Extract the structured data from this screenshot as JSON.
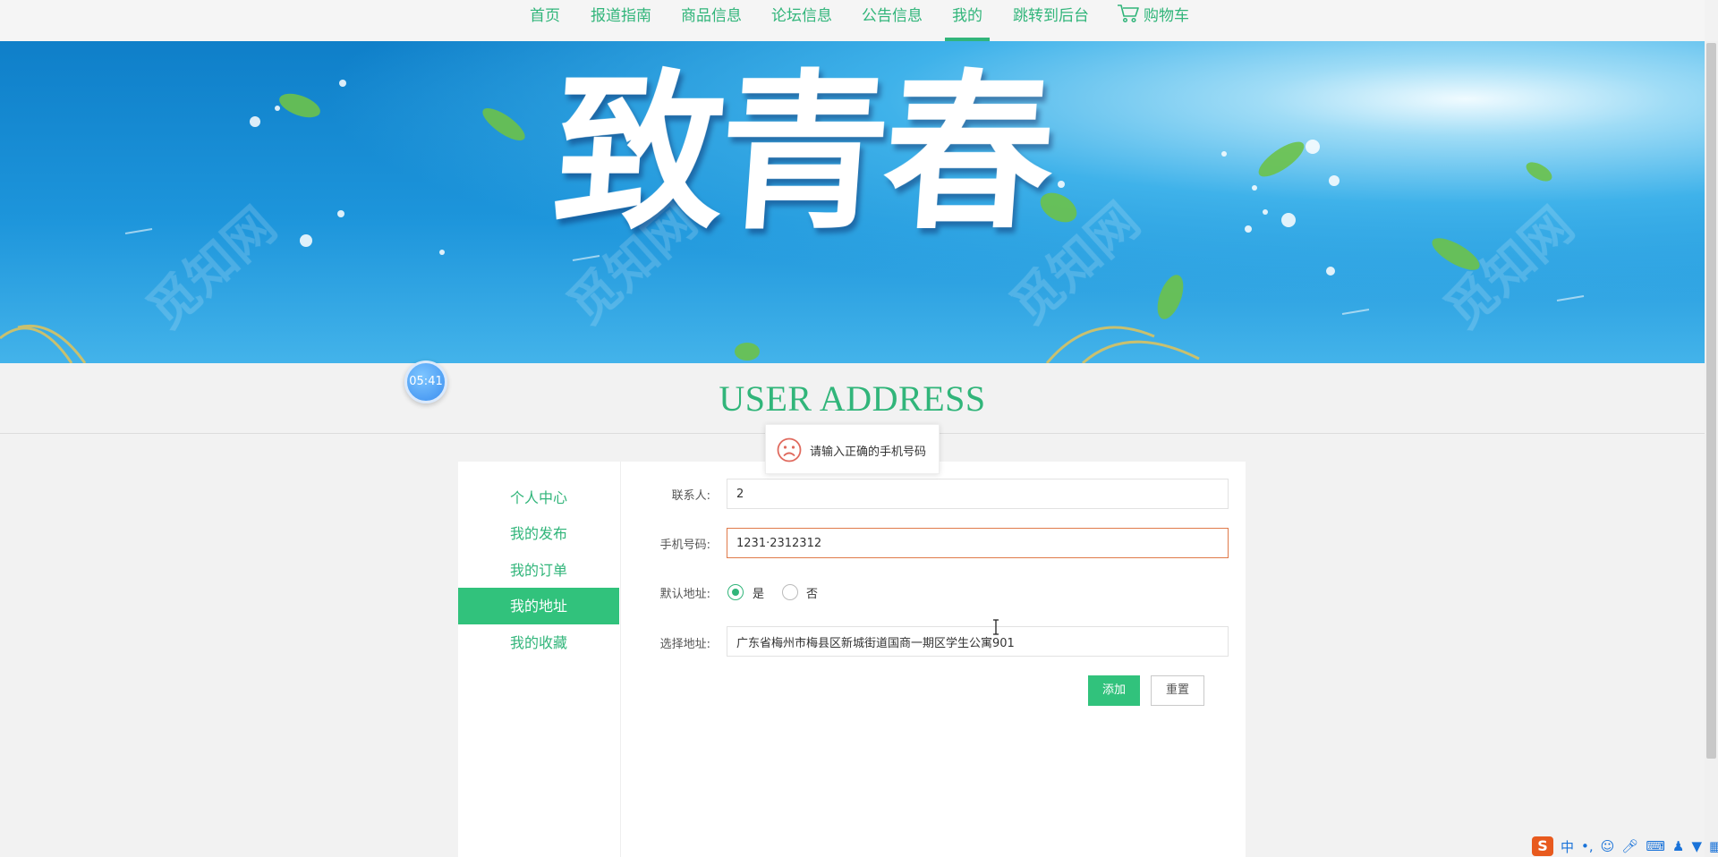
{
  "nav": {
    "items": [
      {
        "label": "首页"
      },
      {
        "label": "报道指南"
      },
      {
        "label": "商品信息"
      },
      {
        "label": "论坛信息"
      },
      {
        "label": "公告信息"
      },
      {
        "label": "我的"
      },
      {
        "label": "跳转到后台"
      }
    ],
    "cart_label": "购物车",
    "active_item": "我的"
  },
  "banner": {
    "title": "致青春",
    "watermark": "觅知网"
  },
  "section": {
    "title": "USER ADDRESS"
  },
  "timer": {
    "text": "05:41"
  },
  "toast": {
    "message": "请输入正确的手机号码",
    "icon": "sad-face-icon"
  },
  "sidebar": {
    "items": [
      {
        "label": "个人中心"
      },
      {
        "label": "我的发布"
      },
      {
        "label": "我的订单"
      },
      {
        "label": "我的地址"
      },
      {
        "label": "我的收藏"
      }
    ],
    "active_item": "我的地址"
  },
  "form": {
    "contact_label": "联系人:",
    "contact_value": "2",
    "phone_label": "手机号码:",
    "phone_value": "1231·2312312",
    "default_label": "默认地址:",
    "default_yes": "是",
    "default_no": "否",
    "default_selected": "是",
    "address_label": "选择地址:",
    "address_value": "广东省梅州市梅县区新城街道国商一期区学生公寓901",
    "submit_label": "添加",
    "reset_label": "重置"
  },
  "ime": {
    "logo": "S",
    "mode": "中"
  },
  "colors": {
    "accent": "#31b57a",
    "button_green": "#31c27c",
    "error_border": "#e07a4a",
    "banner_blue": "#1d95db"
  }
}
